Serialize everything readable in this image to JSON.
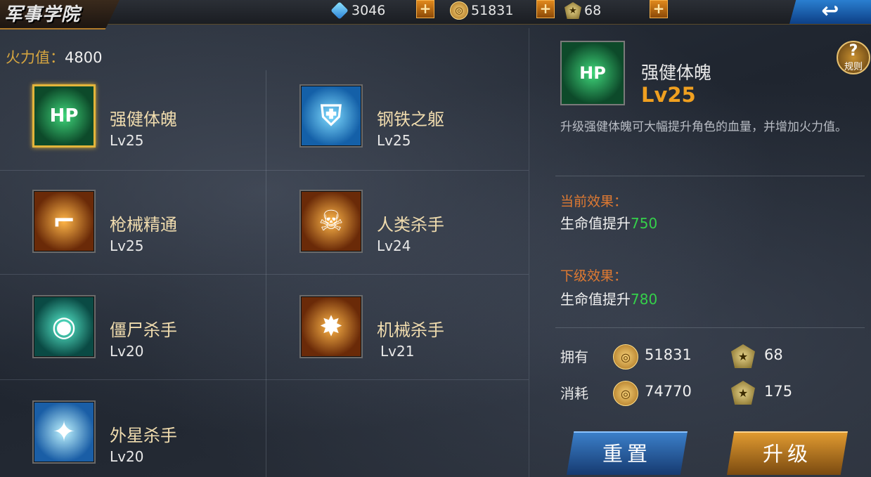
{
  "header": {
    "title": "军事学院",
    "gems": "3046",
    "coins": "51831",
    "medals": "68",
    "back_icon": "back-arrow-icon"
  },
  "firepower": {
    "label": "火力值：",
    "value": "4800"
  },
  "skills": [
    {
      "name": "强健体魄",
      "level": "Lv25",
      "icon_text": "HP",
      "icon": "muscle-hp-icon",
      "selected": true
    },
    {
      "name": "钢铁之躯",
      "level": "Lv25",
      "icon": "armor-body-icon"
    },
    {
      "name": "枪械精通",
      "level": "Lv25",
      "icon": "rifle-icon"
    },
    {
      "name": "人类杀手",
      "level": "Lv24",
      "icon": "skull-target-icon"
    },
    {
      "name": "僵尸杀手",
      "level": "Lv20",
      "icon": "soldier-helmet-icon"
    },
    {
      "name": "机械杀手",
      "level": "Lv21",
      "icon": "mech-explosion-icon"
    },
    {
      "name": "外星杀手",
      "level": "Lv20",
      "icon": "alien-laser-icon"
    }
  ],
  "detail": {
    "name": "强健体魄",
    "level": "Lv25",
    "icon_text": "HP",
    "rules_label": "规则",
    "description": "升级强健体魄可大幅提升角色的血量，并增加火力值。",
    "current_label": "当前效果：",
    "current_text": "生命值提升",
    "current_value": "750",
    "next_label": "下级效果：",
    "next_text": "生命值提升",
    "next_value": "780",
    "own_label": "拥有",
    "own_coins": "51831",
    "own_medals": "68",
    "cost_label": "消耗",
    "cost_coins": "74770",
    "cost_medals": "175"
  },
  "buttons": {
    "reset": "重置",
    "upgrade": "升级"
  },
  "colors": {
    "accent_gold": "#e3b43a",
    "level_orange": "#f0a020",
    "effect_green": "#35d04a",
    "label_orange": "#e07a32"
  }
}
